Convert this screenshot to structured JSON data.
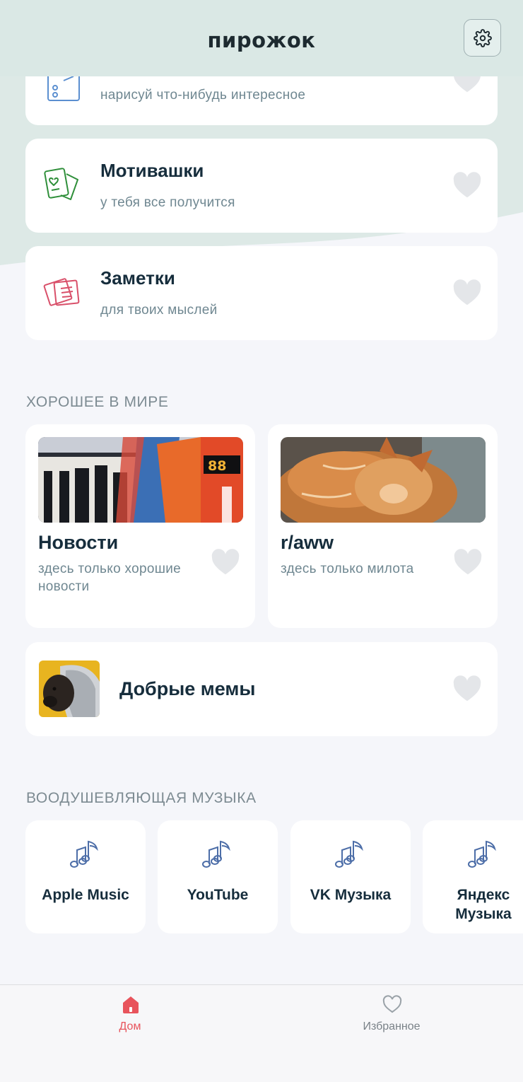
{
  "header": {
    "logo": "пирожок",
    "settings_icon": "gear-icon"
  },
  "cards": [
    {
      "title": "",
      "subtitle": "нарисуй что-нибудь интересное",
      "icon": "drawing-icon"
    },
    {
      "title": "Мотивашки",
      "subtitle": "у тебя все получится",
      "icon": "cards-heart-icon"
    },
    {
      "title": "Заметки",
      "subtitle": "для твоих мыслей",
      "icon": "notes-icon"
    }
  ],
  "sections": {
    "good": {
      "title": "ХОРОШЕЕ В МИРЕ"
    },
    "music": {
      "title": "ВООДУШЕВЛЯЮЩАЯ МУЗЫКА"
    }
  },
  "good_items": [
    {
      "title": "Новости",
      "desc": "здесь только хорошие новости",
      "image_text": "88"
    },
    {
      "title": "r/aww",
      "desc": "здесь только милота"
    }
  ],
  "memes": {
    "title": "Добрые мемы"
  },
  "music": [
    {
      "label": "Apple Music"
    },
    {
      "label": "YouTube"
    },
    {
      "label": "VK Музыка"
    },
    {
      "label": "Яндекс Музыка"
    }
  ],
  "tabbar": {
    "home": {
      "label": "Дом",
      "active": true
    },
    "favorites": {
      "label": "Избранное",
      "active": false
    }
  },
  "colors": {
    "accent": "#e8545c",
    "header_bg": "#dae8e5",
    "heart_inactive": "#e4e6e9",
    "music_icon": "#4d6ea8",
    "text_dark": "#162d3c",
    "text_muted": "#6f8791"
  }
}
